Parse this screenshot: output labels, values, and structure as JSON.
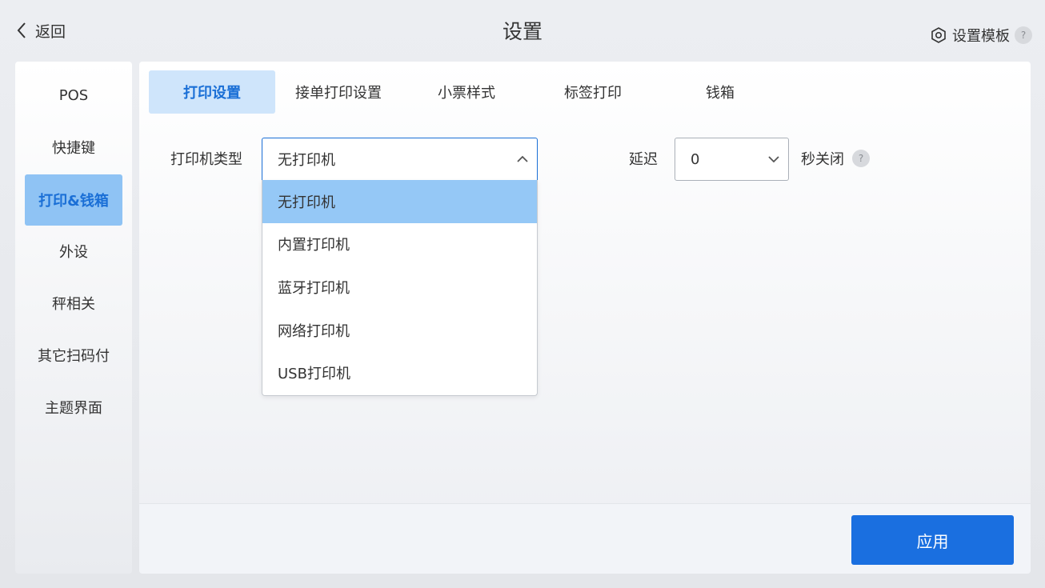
{
  "header": {
    "back_label": "返回",
    "title": "设置",
    "template_label": "设置模板",
    "help_mark": "?"
  },
  "sidebar": {
    "items": [
      {
        "label": "POS"
      },
      {
        "label": "快捷键"
      },
      {
        "label": "打印&钱箱",
        "active": true
      },
      {
        "label": "外设"
      },
      {
        "label": "秤相关"
      },
      {
        "label": "其它扫码付"
      },
      {
        "label": "主题界面"
      }
    ]
  },
  "tabs": [
    {
      "label": "打印设置",
      "active": true
    },
    {
      "label": "接单打印设置"
    },
    {
      "label": "小票样式"
    },
    {
      "label": "标签打印"
    },
    {
      "label": "钱箱"
    }
  ],
  "form": {
    "printer_type_label": "打印机类型",
    "printer_type_value": "无打印机",
    "printer_options": [
      "无打印机",
      "内置打印机",
      "蓝牙打印机",
      "网络打印机",
      "USB打印机"
    ],
    "delay_label": "延迟",
    "delay_value": "0",
    "delay_suffix": "秒关闭",
    "help_mark": "?"
  },
  "footer": {
    "apply_label": "应用"
  },
  "colors": {
    "accent": "#1a6fe0",
    "active_sidebar_bg": "#8fc3f4",
    "active_tab_bg": "#cfe5fb",
    "selected_option_bg": "#95c8f6"
  },
  "icons": {
    "back": "chevron-left-icon",
    "template": "hexagon-gear-icon",
    "dropdown_open": "chevron-up-icon",
    "dropdown_closed": "chevron-down-icon"
  }
}
